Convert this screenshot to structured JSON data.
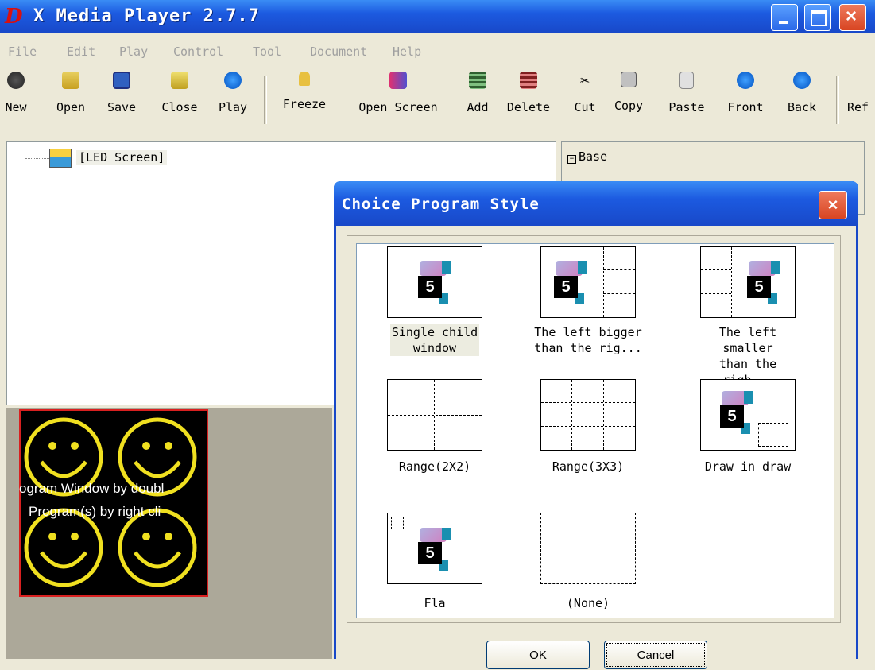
{
  "app": {
    "logo": "D",
    "title": "X Media Player 2.7.7"
  },
  "menu": [
    "File",
    "Edit",
    "Play",
    "Control",
    "Tool",
    "Document",
    "Help"
  ],
  "toolbar": [
    "New",
    "Open",
    "Save",
    "Close",
    "Play",
    "Freeze",
    "Open Screen",
    "Add",
    "Delete",
    "Cut",
    "Copy",
    "Paste",
    "Front",
    "Back",
    "Ref"
  ],
  "tree": {
    "root": "[LED Screen]"
  },
  "properties": {
    "section": "Base",
    "toggle": "−"
  },
  "preview": {
    "line1": "ogram Window by doubl",
    "line2": "Program(s) by right cli"
  },
  "dialog": {
    "title": "Choice Program Style",
    "close": "×",
    "styles": [
      {
        "label1": "Single child",
        "label2": "window"
      },
      {
        "label1": "The left bigger",
        "label2": "than the rig..."
      },
      {
        "label1": "The left smaller",
        "label2": "than the righ..."
      },
      {
        "label1": "Range(2X2)",
        "label2": ""
      },
      {
        "label1": "Range(3X3)",
        "label2": ""
      },
      {
        "label1": "Draw in draw",
        "label2": ""
      },
      {
        "label1": "Fla",
        "label2": ""
      },
      {
        "label1": "(None)",
        "label2": ""
      }
    ],
    "ok": "OK",
    "cancel": "Cancel",
    "pic_digit": "5"
  }
}
